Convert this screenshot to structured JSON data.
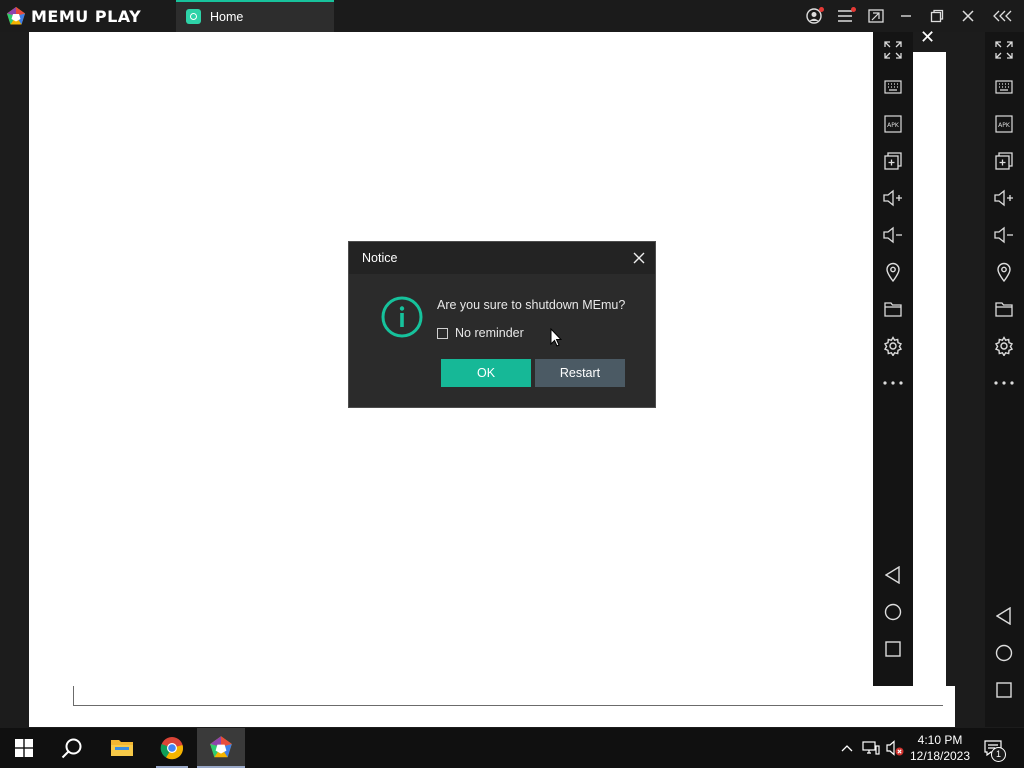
{
  "app": {
    "logo_text": "MEMU PLAY",
    "tab_label": "Home",
    "accent": "#18c29c"
  },
  "titlebar_icons": [
    "user-icon",
    "menu-icon",
    "multi-window-icon",
    "minimize-icon",
    "restore-icon",
    "close-icon",
    "collapse-sidebar-icon"
  ],
  "sidebar_icons": [
    "fullscreen-icon",
    "keyboard-icon",
    "apk-icon",
    "add-window-icon",
    "volume-up-icon",
    "volume-down-icon",
    "location-icon",
    "folder-icon",
    "settings-icon",
    "more-icon",
    "back-icon",
    "home-icon",
    "recents-icon"
  ],
  "dialog": {
    "title": "Notice",
    "message": "Are you sure to shutdown MEmu?",
    "checkbox_label": "No reminder",
    "checkbox_checked": false,
    "ok_label": "OK",
    "restart_label": "Restart",
    "ok_color": "#16b897",
    "restart_color": "#4b5a64"
  },
  "taskbar": {
    "time": "4:10 PM",
    "date": "12/18/2023",
    "notification_count": "1",
    "apps": [
      "windows-start-icon",
      "search-icon",
      "file-explorer-icon",
      "chrome-icon",
      "memu-icon"
    ]
  }
}
